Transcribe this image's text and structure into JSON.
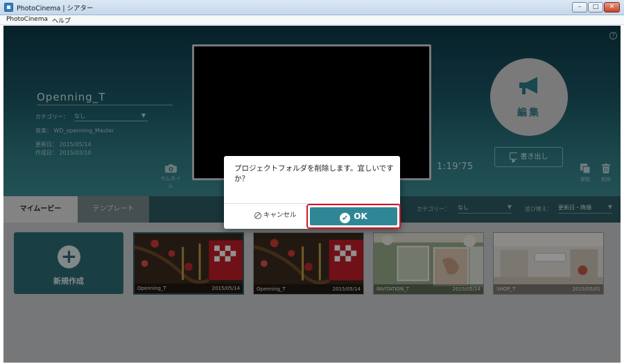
{
  "window": {
    "title": "PhotoCinema | シアター",
    "controls": {
      "minimize": "–",
      "maximize": "□",
      "close": "✕"
    }
  },
  "menubar": {
    "items": [
      "PhotoCinema",
      "ヘルプ"
    ]
  },
  "project": {
    "name": "Openning_T",
    "category_label": "カテゴリー：",
    "category_value": "なし",
    "music": "音楽： WD_openning_Master",
    "updated": "更新日： 2015/05/14",
    "created": "作成日： 2015/03/10",
    "duration": "1:19'75"
  },
  "actions": {
    "thumbnail": "サムネイル",
    "edit": "編集",
    "export": "書き出し",
    "duplicate": "複製",
    "delete": "削除"
  },
  "tabs": {
    "my_movies": "マイムービー",
    "templates": "テンプレート"
  },
  "filters": {
    "category_label": "カテゴリー：",
    "category_value": "なし",
    "sort_label": "並び替え：",
    "sort_value": "更新日・降順"
  },
  "gallery": {
    "new_label": "新規作成",
    "items": [
      {
        "name": "Openning_T",
        "date": "2015/05/14",
        "selected": true,
        "art": "plum"
      },
      {
        "name": "Openning_T",
        "date": "2015/05/14",
        "selected": false,
        "art": "plum"
      },
      {
        "name": "INVITATION_T",
        "date": "2015/05/14",
        "selected": false,
        "art": "wedding"
      },
      {
        "name": "SHOP_T",
        "date": "2015/05/01",
        "selected": false,
        "art": "shop"
      }
    ]
  },
  "dialog": {
    "message": "プロジェクトフォルダを削除します。宜しいですか？",
    "cancel": "キャンセル",
    "ok": "OK"
  },
  "colors": {
    "accent": "#2f8796",
    "highlight_outline": "#d91424",
    "tab_bar": "#2c5d64"
  },
  "icons": [
    "help-icon",
    "camera-icon",
    "megaphone-icon",
    "export-icon",
    "duplicate-icon",
    "trash-icon",
    "plus-icon",
    "cancel-icon",
    "check-icon",
    "chevron-down-icon"
  ]
}
